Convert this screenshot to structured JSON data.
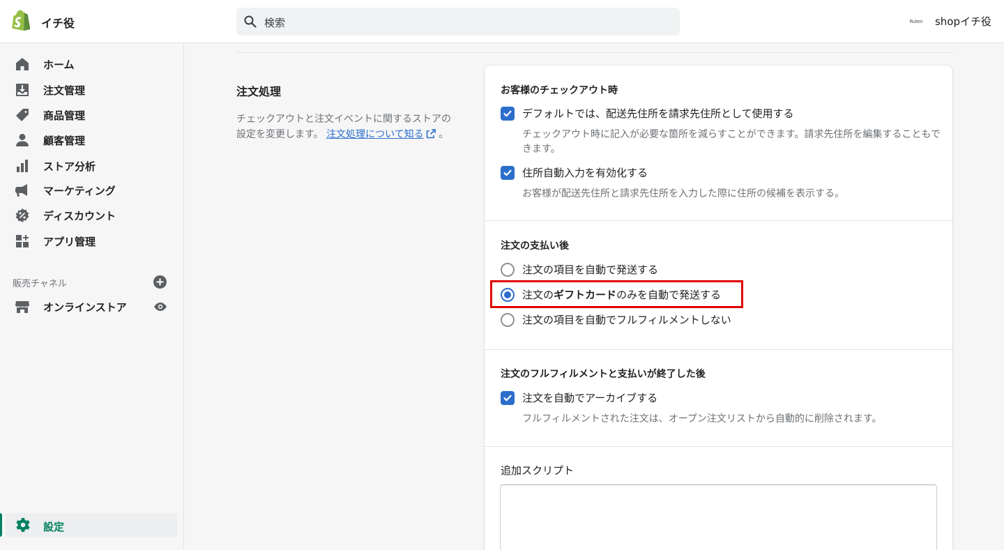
{
  "topbar": {
    "store_name": "イチ役",
    "search_placeholder": "検索",
    "account_logo_text": "Ruten",
    "account_name": "shopイチ役"
  },
  "sidebar": {
    "items": [
      {
        "label": "ホーム",
        "icon": "home-icon"
      },
      {
        "label": "注文管理",
        "icon": "orders-icon"
      },
      {
        "label": "商品管理",
        "icon": "tag-icon"
      },
      {
        "label": "顧客管理",
        "icon": "person-icon"
      },
      {
        "label": "ストア分析",
        "icon": "bar-chart-icon"
      },
      {
        "label": "マーケティング",
        "icon": "megaphone-icon"
      },
      {
        "label": "ディスカウント",
        "icon": "discount-icon"
      },
      {
        "label": "アプリ管理",
        "icon": "apps-icon"
      }
    ],
    "sales_channels_label": "販売チャネル",
    "online_store_label": "オンラインストア",
    "settings_label": "設定"
  },
  "section": {
    "title": "注文処理",
    "description": "チェックアウトと注文イベントに関するストアの設定を変更します。",
    "link_text": "注文処理について知る",
    "period": "。"
  },
  "checkout": {
    "title": "お客様のチェックアウト時",
    "option1_label": "デフォルトでは、配送先住所を請求先住所として使用する",
    "option1_checked": true,
    "option1_help": "チェックアウト時に記入が必要な箇所を減らすことができます。請求先住所を編集することもできます。",
    "option2_label": "住所自動入力を有効化する",
    "option2_checked": true,
    "option2_help": "お客様が配送先住所と請求先住所を入力した際に住所の候補を表示する。"
  },
  "after_payment": {
    "title": "注文の支払い後",
    "radio1_label": "注文の項目を自動で発送する",
    "radio2_prefix": "注文の",
    "radio2_bold": "ギフトカード",
    "radio2_suffix": "のみを自動で発送する",
    "radio3_label": "注文の項目を自動でフルフィルメントしない",
    "selected": "radio2"
  },
  "after_fulfillment": {
    "title": "注文のフルフィルメントと支払いが終了した後",
    "option_label": "注文を自動でアーカイブする",
    "option_checked": true,
    "option_help": "フルフィルメントされた注文は、オープン注文リストから自動的に削除されます。"
  },
  "scripts": {
    "label": "追加スクリプト",
    "value": ""
  },
  "colors": {
    "accent": "#2c6ecb",
    "brand_green": "#008060",
    "highlight_red": "#e00000"
  }
}
